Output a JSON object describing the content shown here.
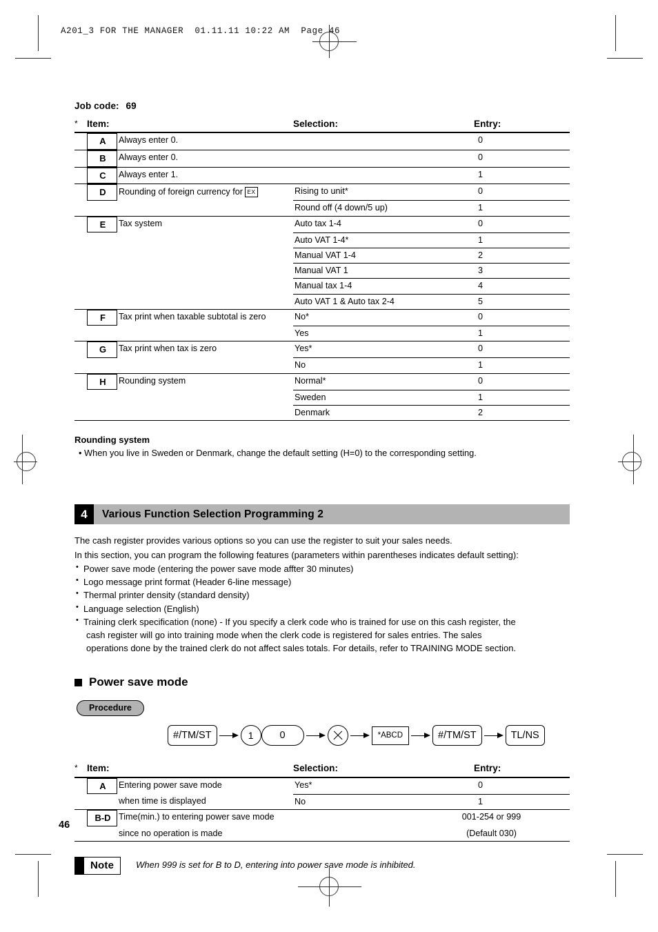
{
  "print_header": "A201_3 FOR THE MANAGER  01.11.11 10:22 AM  Page 46",
  "job_code": {
    "label": "Job code:",
    "value": "69"
  },
  "table_headers": {
    "star": "*",
    "item": "Item:",
    "selection": "Selection:",
    "entry": "Entry:"
  },
  "table1": {
    "rows": [
      {
        "key": "A",
        "item": "Always enter 0.",
        "ex_key": "",
        "options": [
          {
            "selection": "",
            "entry": "0"
          }
        ]
      },
      {
        "key": "B",
        "item": "Always enter 0.",
        "ex_key": "",
        "options": [
          {
            "selection": "",
            "entry": "0"
          }
        ]
      },
      {
        "key": "C",
        "item": "Always enter 1.",
        "ex_key": "",
        "options": [
          {
            "selection": "",
            "entry": "1"
          }
        ]
      },
      {
        "key": "D",
        "item": "Rounding of foreign currency for",
        "ex_key": "EX",
        "options": [
          {
            "selection": "Rising to unit*",
            "entry": "0"
          },
          {
            "selection": "Round off (4 down/5 up)",
            "entry": "1"
          }
        ]
      },
      {
        "key": "E",
        "item": "Tax system",
        "ex_key": "",
        "options": [
          {
            "selection": "Auto tax 1-4",
            "entry": "0"
          },
          {
            "selection": "Auto VAT 1-4*",
            "entry": "1"
          },
          {
            "selection": "Manual VAT 1-4",
            "entry": "2"
          },
          {
            "selection": "Manual VAT 1",
            "entry": "3"
          },
          {
            "selection": "Manual tax 1-4",
            "entry": "4"
          },
          {
            "selection": "Auto VAT 1 & Auto tax 2-4",
            "entry": "5"
          }
        ]
      },
      {
        "key": "F",
        "item": "Tax print when taxable subtotal is zero",
        "ex_key": "",
        "options": [
          {
            "selection": "No*",
            "entry": "0"
          },
          {
            "selection": "Yes",
            "entry": "1"
          }
        ]
      },
      {
        "key": "G",
        "item": "Tax print when tax is zero",
        "ex_key": "",
        "options": [
          {
            "selection": "Yes*",
            "entry": "0"
          },
          {
            "selection": "No",
            "entry": "1"
          }
        ]
      },
      {
        "key": "H",
        "item": "Rounding system",
        "ex_key": "",
        "options": [
          {
            "selection": "Normal*",
            "entry": "0"
          },
          {
            "selection": "Sweden",
            "entry": "1"
          },
          {
            "selection": "Denmark",
            "entry": "2"
          }
        ]
      }
    ]
  },
  "rounding_note": {
    "heading": "Rounding system",
    "bullet": "• When you live in Sweden or Denmark, change the default setting (H=0) to the corresponding setting."
  },
  "section4": {
    "number": "4",
    "title": "Various Function Selection Programming 2",
    "paragraph1": "The cash register provides various options so you can use the register to suit your sales needs.",
    "paragraph2": "In this section, you can program the following features (parameters within parentheses indicates default setting):",
    "bullets": [
      {
        "text": "Power save mode (entering the power save mode affter 30 minutes)",
        "cont": []
      },
      {
        "text": "Logo message print format (Header 6-line message)",
        "cont": []
      },
      {
        "text": "Thermal printer density (standard density)",
        "cont": []
      },
      {
        "text": "Language selection (English)",
        "cont": []
      },
      {
        "text": "Training clerk specification (none) - If you specify a clerk code who is trained for use on this cash register, the",
        "cont": [
          "cash register will go into training mode when the clerk code is registered for sales entries.  The sales",
          "operations done by the trained clerk do not affect sales totals.  For details, refer to TRAINING MODE section."
        ]
      }
    ]
  },
  "power_save": {
    "heading": "Power save mode",
    "procedure_label": "Procedure",
    "keys": [
      {
        "label": "#/TM/ST",
        "shape": "rrect"
      },
      {
        "label": "1",
        "shape": "circle"
      },
      {
        "label": "0",
        "shape": "pill"
      },
      {
        "label": "multiply-icon",
        "shape": "xcircle"
      },
      {
        "label": "*ABCD",
        "shape": "sq"
      },
      {
        "label": "#/TM/ST",
        "shape": "rrect"
      },
      {
        "label": "TL/NS",
        "shape": "rrect"
      }
    ]
  },
  "table2": {
    "rows": [
      {
        "key": "A",
        "item": "Entering power save mode",
        "item2": "when time is displayed",
        "options": [
          {
            "selection": "Yes*",
            "entry": "0"
          },
          {
            "selection": "No",
            "entry": "1"
          }
        ]
      },
      {
        "key": "B-D",
        "item": "Time(min.) to entering power save mode",
        "item2": "since no operation is made",
        "options": [
          {
            "selection": "",
            "entry": "001-254 or 999"
          },
          {
            "selection": "",
            "entry": "(Default 030)"
          }
        ]
      }
    ]
  },
  "note": {
    "label": "Note",
    "text": "When 999 is set for B to D, entering into power save mode is inhibited."
  },
  "page_number": "46"
}
